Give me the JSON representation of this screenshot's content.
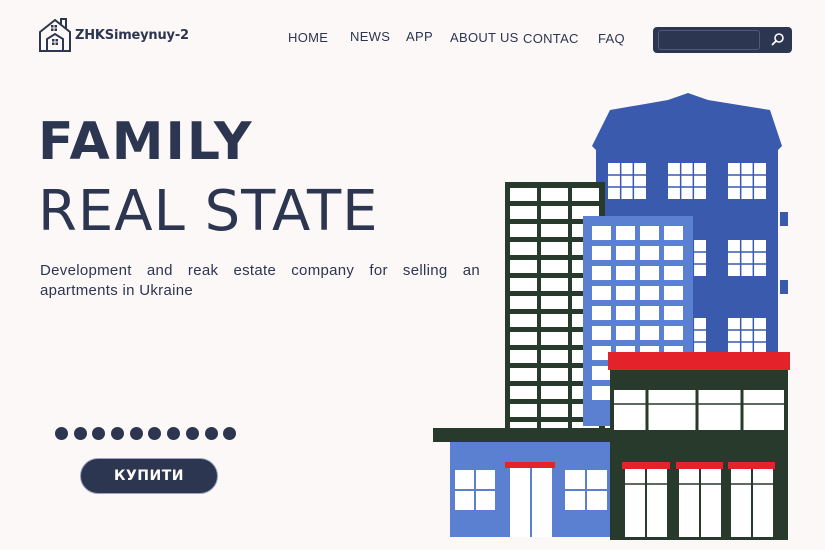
{
  "brand": {
    "name": "ZHKSimeynuy-2",
    "icon": "house-building-logo-icon"
  },
  "nav": {
    "items": [
      {
        "label": "HOME"
      },
      {
        "label": "NEWS"
      },
      {
        "label": "APP"
      },
      {
        "label": "ABOUT US"
      },
      {
        "label": "CONTAC"
      },
      {
        "label": "FAQ"
      }
    ]
  },
  "search": {
    "value": "",
    "placeholder": "",
    "icon": "search-icon"
  },
  "hero": {
    "title_line1": "FAMILY",
    "title_line2": "REAL STATE",
    "subtitle": "Development and reak estate company for selling an apartments in Ukraine",
    "cta_label": "КУПИТИ",
    "dots_count": 10
  },
  "illustration": {
    "icon": "city-buildings-illustration"
  },
  "colors": {
    "navy": "#2d3650",
    "background": "#fcf8f7",
    "blue": "#3a5aad",
    "light_blue": "#5b7fd1",
    "dark_green": "#283a2c",
    "red": "#e4222a"
  }
}
